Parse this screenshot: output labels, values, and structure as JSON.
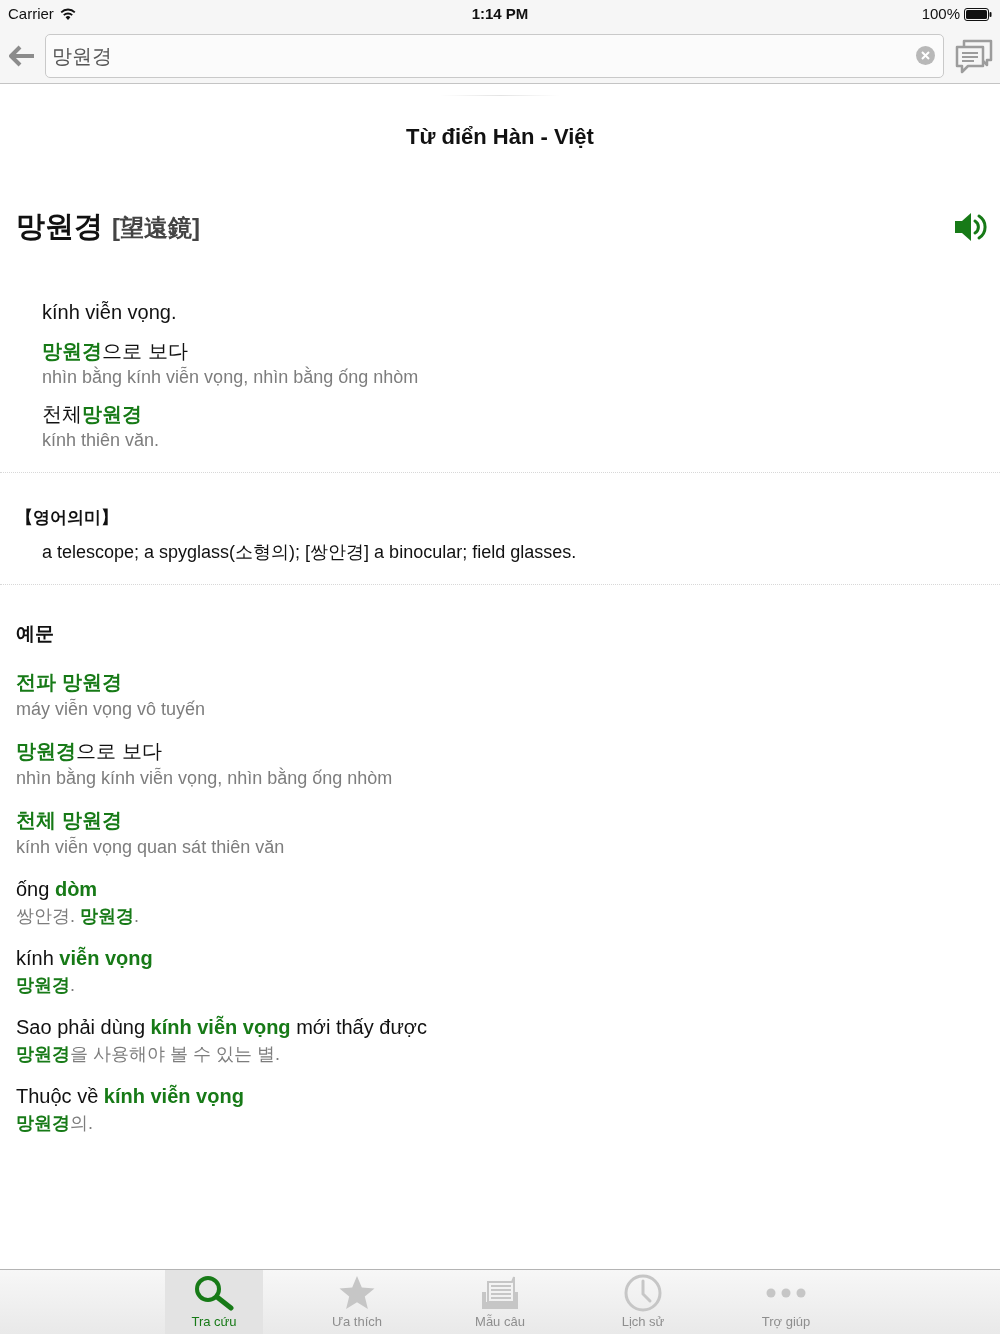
{
  "status_bar": {
    "carrier": "Carrier",
    "time": "1:14 PM",
    "battery": "100%"
  },
  "toolbar": {
    "search": {
      "value": "망원경"
    }
  },
  "dictionary_title": "Từ điển Hàn - Việt",
  "entry": {
    "headword": "망원경",
    "hanja": "[望遠鏡]",
    "meanings": [
      {
        "definition": "kính viễn vọng.",
        "examples": [
          {
            "phrase": "**망원경**으로 보다",
            "translation": "nhìn bằng kính viễn vọng, nhìn bằng ống nhòm"
          },
          {
            "phrase": "천체**망원경**",
            "translation": "kính thiên văn."
          }
        ]
      }
    ]
  },
  "english_meaning": {
    "heading": "【영어의미】",
    "text": "a telescope; a spyglass(소형의); [쌍안경] a binocular; field glasses."
  },
  "examples": {
    "heading": "예문",
    "items": [
      {
        "kind": "term",
        "phrase": "전파 망원경",
        "translation": "máy viễn vọng vô tuyến"
      },
      {
        "kind": "sentence",
        "phrase": "**망원경**으로 보다",
        "translation": "nhìn bằng kính viễn vọng, nhìn bằng ống nhòm"
      },
      {
        "kind": "term",
        "phrase": "천체 망원경",
        "translation": "kính viễn vọng quan sát thiên văn"
      },
      {
        "kind": "sentence",
        "phrase": "ống **dòm**",
        "translation": "쌍안경. **망원경**."
      },
      {
        "kind": "sentence",
        "phrase": "kính **viễn vọng**",
        "translation": "**망원경**."
      },
      {
        "kind": "sentence",
        "phrase": "Sao phải dùng **kính viễn vọng** mới thấy được",
        "translation": "**망원경**을 사용해야 볼 수 있는 별."
      },
      {
        "kind": "sentence",
        "phrase": "Thuộc về **kính viễn vọng**",
        "translation": "**망원경**의."
      }
    ]
  },
  "tab_bar": [
    {
      "label": "Tra cứu",
      "selected": true
    },
    {
      "label": "Ưa thích",
      "selected": false
    },
    {
      "label": "Mẫu câu",
      "selected": false
    },
    {
      "label": "Lịch sử",
      "selected": false
    },
    {
      "label": "Trợ giúp",
      "selected": false
    }
  ]
}
